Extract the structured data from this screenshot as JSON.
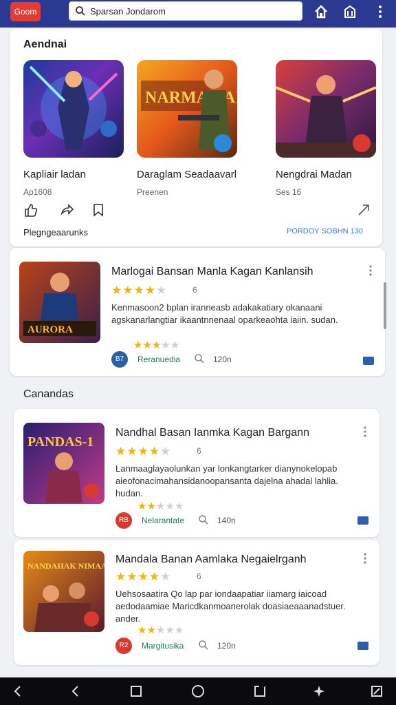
{
  "topbar": {
    "logo_text": "Goom",
    "search_value": "Sparsan Jondarom",
    "icons": [
      "search-icon",
      "home-icon",
      "store-icon",
      "more-vert-icon"
    ]
  },
  "featured": {
    "title": "Aendnai",
    "items": [
      {
        "name": "Kapliair ladan",
        "sub": "Ap1608"
      },
      {
        "name": "Daraglam Seadaavarl",
        "sub": "Preenen"
      },
      {
        "name": "Nengdrai Madan",
        "sub": "Ses 16"
      }
    ],
    "art_text": "NARMAN AI",
    "footer_label": "Plegngeaarunks",
    "footer_link": "PORDOY SOBHN 130"
  },
  "section2_title": "Canandas",
  "cards": [
    {
      "art_text": "AURORA",
      "title": "Marlogai Bansan Manla Kagan Kanlansih",
      "rating": 3.5,
      "count": "6",
      "desc": "Kenmasoon2 bplan iranneasb adakakatiary okanaani agskanarlangtiar ikaantnnenaal oparkeaohta iaiin. sudan.",
      "small_rating": 2.5,
      "pub_icon": "B7",
      "pub_color": "#2b5fa8",
      "publisher": "Reranuedia",
      "size": "120n"
    },
    {
      "art_text": "PANDAS-1",
      "title": "Nandhal Basan Ianmka Kagan Bargann",
      "rating": 3.5,
      "count": "6",
      "desc": "Lanmaaglayaolunkan yar lonkangtarker dianynokelopab aieofonacimahansidanoopansanta dajelna ahadal lahlia. hudan.",
      "small_rating": 2,
      "pub_icon": "RB",
      "pub_color": "#d93a30",
      "publisher": "Nelarantate",
      "size": "140n"
    },
    {
      "art_text": "NANDAHAK NIMAAN",
      "title": "Mandala Banan Aamlaka Negaielrganh",
      "rating": 3.5,
      "count": "6",
      "desc": "Uehsosaatira Qo lap par iondaapatiar iiamarg iaicoad aedodaamiae Maricdkanmoanerolak doasiaeaaanadstuer. ander.",
      "small_rating": 1.5,
      "pub_icon": "R2",
      "pub_color": "#d93a30",
      "publisher": "Margitusika",
      "size": "120n"
    }
  ],
  "colors": {
    "topbar": "#2b3990",
    "accent": "#e53a35",
    "star": "#f4b400",
    "publisher": "#1e7e4a"
  }
}
